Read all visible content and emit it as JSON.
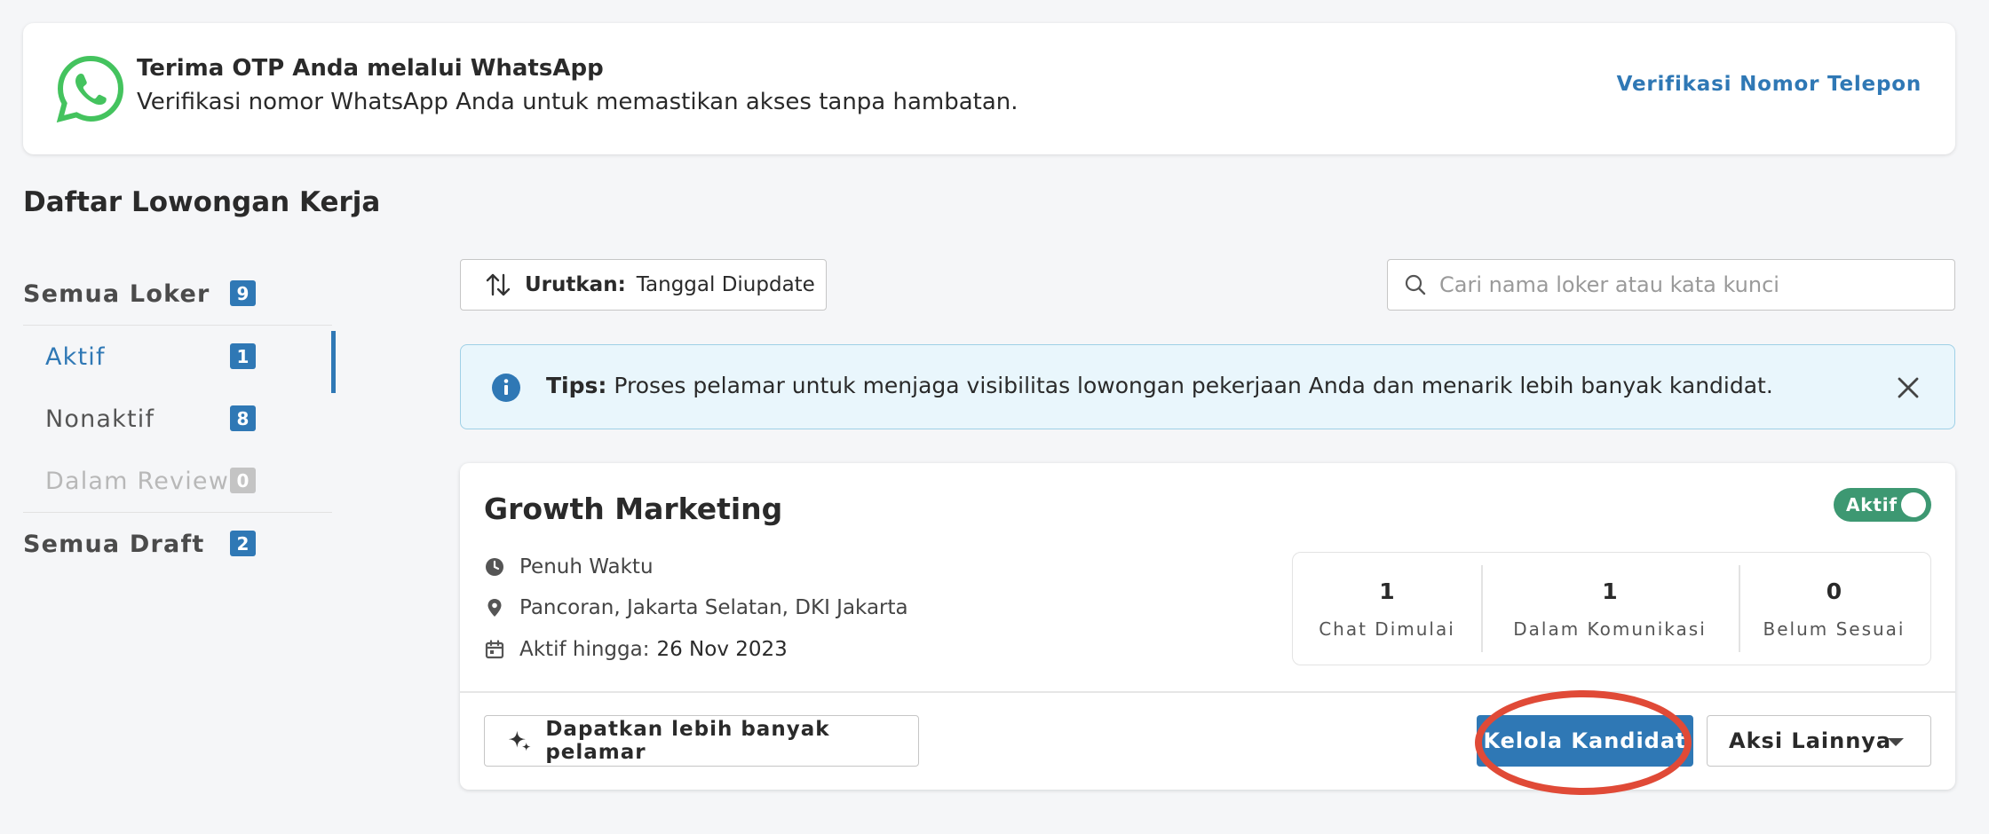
{
  "whatsapp_banner": {
    "title": "Terima OTP Anda melalui WhatsApp",
    "description": "Verifikasi nomor WhatsApp Anda untuk memastikan akses tanpa hambatan.",
    "link": "Verifikasi Nomor Telepon",
    "icon": "whatsapp-icon",
    "icon_color": "#44c35e"
  },
  "section_title": "Daftar Lowongan Kerja",
  "sidebar": {
    "all_jobs": {
      "label": "Semua Loker",
      "count": "9"
    },
    "items": [
      {
        "label": "Aktif",
        "count": "1",
        "active": true
      },
      {
        "label": "Nonaktif",
        "count": "8"
      },
      {
        "label": "Dalam Review",
        "count": "0",
        "disabled": true
      }
    ],
    "drafts": {
      "label": "Semua Draft",
      "count": "2"
    }
  },
  "toolbar": {
    "sort_key": "Urutkan:",
    "sort_value": "Tanggal Diupdate",
    "search_placeholder": "Cari nama loker atau kata kunci"
  },
  "tips": {
    "label": "Tips:",
    "text": " Proses pelamar untuk menjaga visibilitas lowongan pekerjaan Anda dan menarik lebih banyak kandidat."
  },
  "job": {
    "title": "Growth Marketing",
    "status": "Aktif",
    "type": "Penuh Waktu",
    "location": "Pancoran, Jakarta Selatan, DKI Jakarta",
    "active_until_label": "Aktif hingga:",
    "active_until_date": "26 Nov 2023",
    "stats": [
      {
        "value": "1",
        "label": "Chat Dimulai"
      },
      {
        "value": "1",
        "label": "Dalam Komunikasi"
      },
      {
        "value": "0",
        "label": "Belum Sesuai"
      }
    ],
    "promo_button": "Dapatkan lebih banyak pelamar",
    "manage_button": "Kelola Kandidat",
    "more_button": "Aksi Lainnya"
  },
  "colors": {
    "accent": "#2f78b5",
    "status_green": "#3d9872",
    "highlight_red": "#e04a37",
    "tips_bg": "#e9f6fc"
  }
}
